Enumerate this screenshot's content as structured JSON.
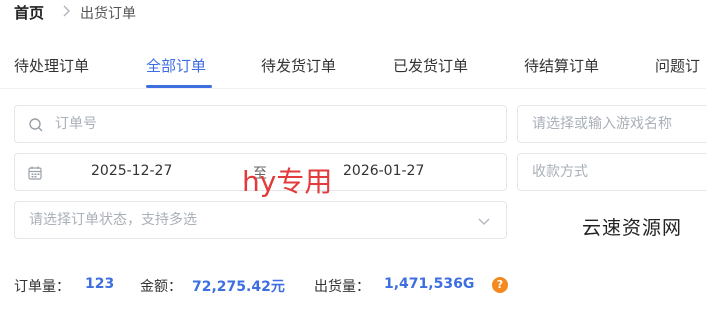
{
  "breadcrumb": {
    "home": "首页",
    "current": "出货订单"
  },
  "tabs": [
    {
      "label": "待处理订单",
      "active": false
    },
    {
      "label": "全部订单",
      "active": true
    },
    {
      "label": "待发货订单",
      "active": false
    },
    {
      "label": "已发货订单",
      "active": false
    },
    {
      "label": "待结算订单",
      "active": false
    },
    {
      "label": "问题订",
      "active": false
    }
  ],
  "filters": {
    "order_no_placeholder": "订单号",
    "game_placeholder": "请选择或输入游戏名称",
    "date_start": "2025-12-27",
    "date_separator": "至",
    "date_end": "2026-01-27",
    "payment_placeholder": "收款方式",
    "status_placeholder": "请选择订单状态，支持多选"
  },
  "watermark": "hy专用",
  "side_watermark": "云速资源网",
  "stats": {
    "order_count_label": "订单量：",
    "order_count": "123",
    "amount_label": "金额：",
    "amount": "72,275.42元",
    "shipment_label": "出货量：",
    "shipment": "1,471,536G",
    "help_icon": "?"
  },
  "colors": {
    "accent": "#3d6fe0",
    "warning": "#f4891f",
    "watermark": "#e23b3b"
  }
}
